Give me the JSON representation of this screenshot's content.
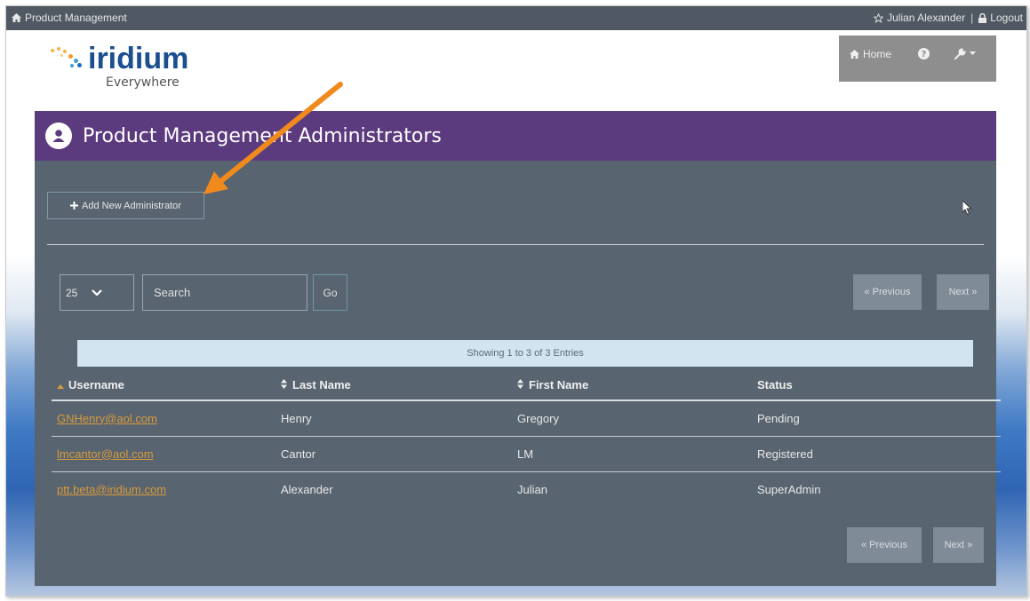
{
  "topbar": {
    "app_title": "Product Management",
    "user_name": "Julian Alexander",
    "separator": "|",
    "logout_label": "Logout"
  },
  "logo": {
    "brand": "iridium",
    "tagline": "Everywhere"
  },
  "nav": {
    "home_label": "Home"
  },
  "panel": {
    "title": "Product Management Administrators",
    "add_button_label": "Add New Administrator"
  },
  "controls": {
    "page_size": "25",
    "search_placeholder": "Search",
    "go_label": "Go",
    "previous_label": "« Previous",
    "next_label": "Next »",
    "showing_text": "Showing 1 to 3 of 3 Entries"
  },
  "table": {
    "headers": {
      "username": "Username",
      "last_name": "Last Name",
      "first_name": "First Name",
      "status": "Status"
    },
    "rows": [
      {
        "username": "GNHenry@aol.com",
        "last_name": "Henry",
        "first_name": "Gregory",
        "status": "Pending"
      },
      {
        "username": "lmcantor@aol.com",
        "last_name": "Cantor",
        "first_name": "LM",
        "status": "Registered"
      },
      {
        "username": "ptt.beta@iridium.com",
        "last_name": "Alexander",
        "first_name": "Julian",
        "status": "SuperAdmin"
      }
    ]
  },
  "colors": {
    "header_purple": "#5b3a7e",
    "panel_gray": "#58646f",
    "link_orange": "#d89b3c",
    "annotation_arrow": "#f08a1c"
  }
}
